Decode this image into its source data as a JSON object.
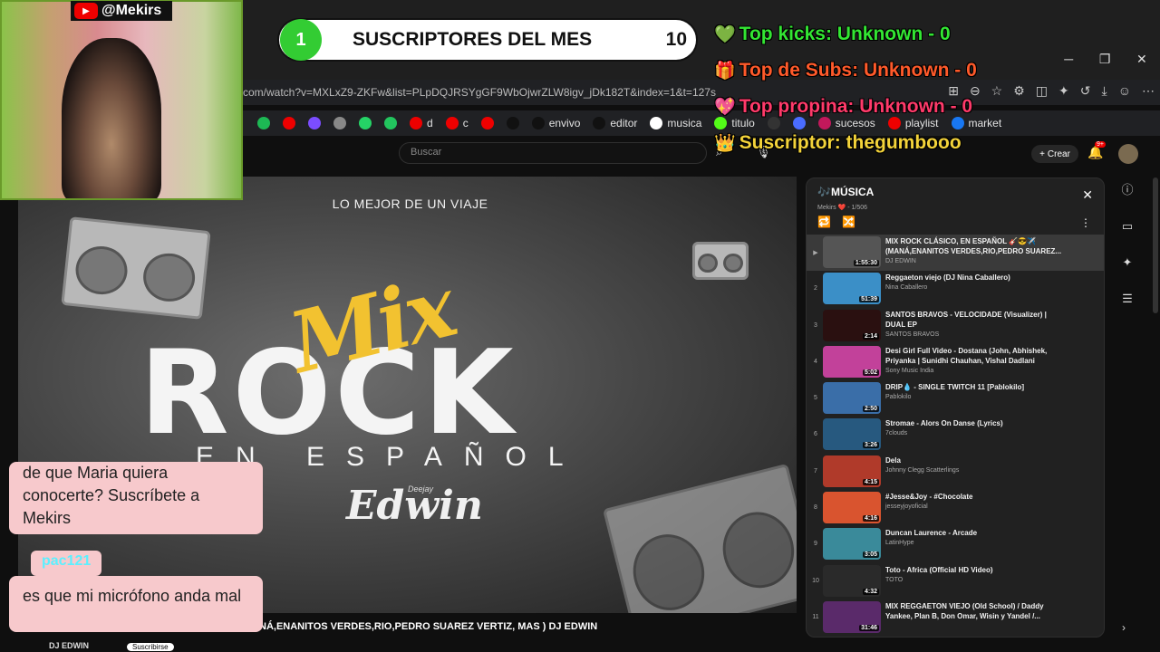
{
  "overlay": {
    "cam_handle": "@Mekirs",
    "subs_position": "1",
    "subs_label": "SUSCRIPTORES DEL MES",
    "subs_count": "10",
    "stats": [
      {
        "icon": "heart-icon",
        "glyph": "💚",
        "text": "Top kicks: Unknown - 0",
        "color": "#33e633"
      },
      {
        "icon": "gift-icon",
        "glyph": "🎁",
        "text": "Top de Subs: Unknown - 0",
        "color": "#ff5a2a"
      },
      {
        "icon": "heart-icon",
        "glyph": "💖",
        "text": "Top propina: Unknown - 0",
        "color": "#ff3a6a"
      },
      {
        "icon": "crown-icon",
        "glyph": "👑",
        "text": "Suscriptor: thegumbooo",
        "color": "#f3d33a"
      }
    ],
    "chat_messages": [
      "de que Maria quiera conocerte? Suscríbete a Mekirs",
      "es que mi micrófono anda mal"
    ],
    "chat_user": "pac121"
  },
  "browser": {
    "url": "com/watch?v=MXLxZ9-ZKFw&list=PLpDQJRSYgGF9WbOjwrZLW8igv_jDk182T&index=1&t=127s",
    "bookmarks": [
      {
        "label": "",
        "color": "#1db954"
      },
      {
        "label": "",
        "color": "#e00"
      },
      {
        "label": "",
        "color": "#7b4dff"
      },
      {
        "label": "",
        "color": "#888"
      },
      {
        "label": "",
        "color": "#25d366"
      },
      {
        "label": "",
        "color": "#22c55e"
      },
      {
        "label": "d",
        "color": "#e00"
      },
      {
        "label": "c",
        "color": "#e00"
      },
      {
        "label": "",
        "color": "#e00"
      },
      {
        "label": "",
        "color": "#111"
      },
      {
        "label": "envivo",
        "color": "#111"
      },
      {
        "label": "editor",
        "color": "#111"
      },
      {
        "label": "musica",
        "color": "#fff"
      },
      {
        "label": "titulo",
        "color": "#53fc18"
      },
      {
        "label": "",
        "color": "#333"
      },
      {
        "label": "",
        "color": "#4a6cff"
      },
      {
        "label": "sucesos",
        "color": "#c2185b"
      },
      {
        "label": "playlist",
        "color": "#e00"
      },
      {
        "label": "market",
        "color": "#1877f2"
      }
    ]
  },
  "youtube": {
    "search_placeholder": "Buscar",
    "create_label": "Crear",
    "notif_count": "9+"
  },
  "video": {
    "top_text": "LO MEJOR DE UN VIAJE",
    "mix": "Mix",
    "rock": "ROCK",
    "espanol": "EN ESPAÑOL",
    "dj_name": "Edwin",
    "deejay": "Deejay",
    "title": "NÁ,ENANITOS VERDES,RIO,PEDRO SUAREZ VERTIZ, MAS ) DJ EDWIN",
    "channel": "DJ EDWIN",
    "subscribe": "Suscribirse"
  },
  "playlist": {
    "title": "MÚSICA",
    "subtitle": "Mekirs ❤️ - 1/506",
    "items": [
      {
        "idx": "▶",
        "name": "MIX ROCK CLÁSICO, EN ESPAÑOL 🎸😎✈️ (MANÁ,ENANITOS VERDES,RIO,PEDRO SUAREZ...",
        "by": "DJ EDWIN",
        "dur": "1:55:30",
        "color": "#555555"
      },
      {
        "idx": "2",
        "name": "Reggaeton viejo (DJ Nina Caballero)",
        "by": "Nina Caballero",
        "dur": "51:39",
        "color": "#3b8fc7"
      },
      {
        "idx": "3",
        "name": "SANTOS BRAVOS - VELOCIDADE (Visualizer) | DUAL EP",
        "by": "SANTOS BRAVOS",
        "dur": "2:14",
        "color": "#2a1010"
      },
      {
        "idx": "4",
        "name": "Desi Girl Full Video - Dostana (John, Abhishek, Priyanka | Sunidhi Chauhan, Vishal Dadlani",
        "by": "Sony Music India",
        "dur": "5:02",
        "color": "#c2419a"
      },
      {
        "idx": "5",
        "name": "DRIP💧 - SINGLE TWITCH 11 [Pablokilo]",
        "by": "Pablokilo",
        "dur": "2:50",
        "color": "#3a6ea8"
      },
      {
        "idx": "6",
        "name": "Stromae - Alors On Danse (Lyrics)",
        "by": "7clouds",
        "dur": "3:26",
        "color": "#27597f"
      },
      {
        "idx": "7",
        "name": "Dela",
        "by": "Johnny Clegg Scatterlings",
        "dur": "4:15",
        "color": "#b03a2a"
      },
      {
        "idx": "8",
        "name": "#Jesse&Joy - #Chocolate",
        "by": "jesseyjoyoficial",
        "dur": "4:16",
        "color": "#d9542f"
      },
      {
        "idx": "9",
        "name": "Duncan Laurence - Arcade",
        "by": "LatinHype",
        "dur": "3:05",
        "color": "#3a8a9a"
      },
      {
        "idx": "10",
        "name": "Toto - Africa (Official HD Video)",
        "by": "TOTO",
        "dur": "4:32",
        "color": "#2a2a2a"
      },
      {
        "idx": "11",
        "name": "MIX REGGAETON VIEJO (Old School) / Daddy Yankee, Plan B, Don Omar, Wisin y Yandel /...",
        "by": "",
        "dur": "31:46",
        "color": "#5a2a6a"
      }
    ]
  }
}
